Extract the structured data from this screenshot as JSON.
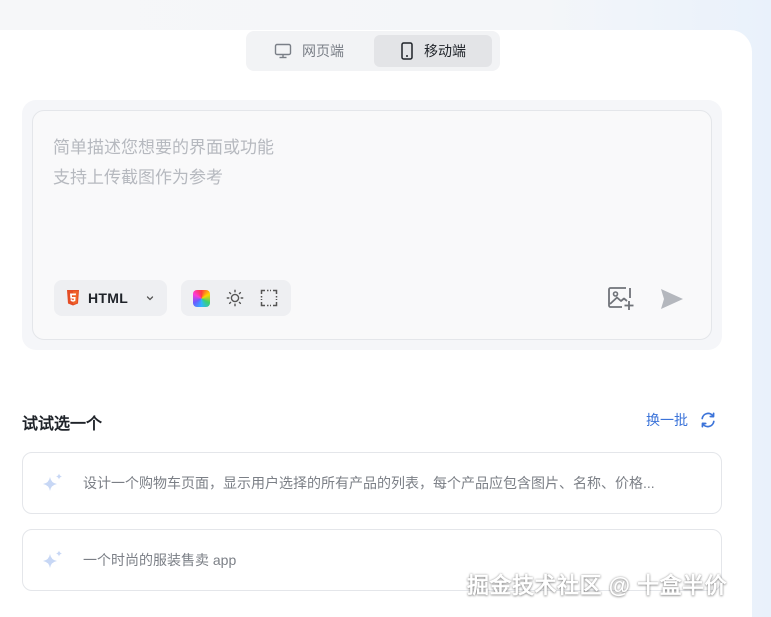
{
  "platform_toggle": {
    "web_label": "网页端",
    "mobile_label": "移动端",
    "selected": "mobile"
  },
  "prompt": {
    "placeholder": "简单描述您想要的界面或功能\n支持上传截图作为参考",
    "value": ""
  },
  "framework_select": {
    "value": "HTML",
    "icon": "html5-icon"
  },
  "tools": [
    "color-palette-icon",
    "theme-sun-icon",
    "screenshot-crop-icon"
  ],
  "actions": {
    "upload_icon": "image-upload-icon",
    "send_icon": "send-icon"
  },
  "suggestions_section": {
    "title": "试试选一个",
    "refresh_label": "换一批"
  },
  "suggestions": [
    "设计一个购物车页面，显示用户选择的所有产品的列表，每个产品应包含图片、名称、价格...",
    "一个时尚的服装售卖 app"
  ],
  "watermark": "掘金技术社区 @ 十盒半价",
  "colors": {
    "accent": "#3b73d9",
    "html5": "#e44d26"
  }
}
